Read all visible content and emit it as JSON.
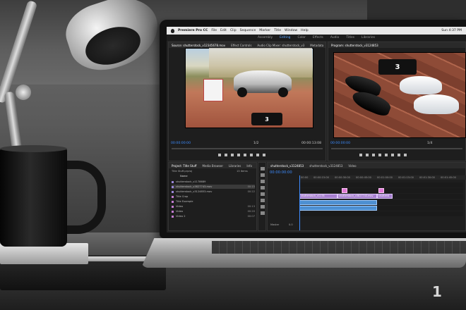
{
  "scene": {
    "brand_mark": "1"
  },
  "menubar": {
    "app_name": "Premiere Pro CC",
    "items": [
      "File",
      "Edit",
      "Clip",
      "Sequence",
      "Marker",
      "Title",
      "Window",
      "Help"
    ],
    "clock": "Sun 4:37 PM"
  },
  "workspaces": [
    "Assembly",
    "Editing",
    "Color",
    "Effects",
    "Audio",
    "Titles",
    "Libraries"
  ],
  "workspace_active": "Editing",
  "source_monitor": {
    "tabs": [
      "Source: shutterstock_v12345678.mov",
      "Effect Controls",
      "Audio Clip Mixer: shutterstock_v3",
      "Metadata"
    ],
    "timecode_left": "00:00:00:00",
    "timecode_right": "00:00:13:08",
    "zoom": "1/2",
    "logo": "3"
  },
  "program_monitor": {
    "tabs": [
      "Program: shutterstock_v3124853"
    ],
    "timecode_left": "00:00:00:00",
    "zoom": "1/4",
    "logo": "3"
  },
  "project": {
    "tabs": [
      "Project: Title Stuff",
      "Media Browser",
      "Libraries",
      "Info"
    ],
    "path": "Title Stuff.prproj",
    "item_count": "13 Items",
    "col_name": "Name",
    "rows": [
      {
        "name": "shutterstock_v1178689",
        "dur": "",
        "color": "#9a86d8"
      },
      {
        "name": "shutterstock_v3827743.mov",
        "dur": "00:15",
        "color": "#9a86d8"
      },
      {
        "name": "shutterstock_v3124853.mov",
        "dur": "00:22",
        "color": "#9a86d8"
      },
      {
        "name": "Title Crop",
        "dur": "",
        "color": "#c27bd0"
      },
      {
        "name": "Title Example",
        "dur": "",
        "color": "#c27bd0"
      },
      {
        "name": "Video",
        "dur": "00:13",
        "color": "#c27bd0"
      },
      {
        "name": "Video",
        "dur": "00:20",
        "color": "#c27bd0"
      },
      {
        "name": "Video 2",
        "dur": "00:07",
        "color": "#c27bd0"
      }
    ]
  },
  "timeline": {
    "tabs": [
      "shutterstock_v3124853",
      "shutterstock_v3124853",
      "Video"
    ],
    "timecode": "00:00:00:00",
    "ruler": [
      "00:00",
      "00:00:15:00",
      "00:00:30:00",
      "00:00:45:00",
      "00:01:00:00",
      "00:01:15:00",
      "00:01:30:00",
      "00:01:45:00"
    ],
    "video_clips": [
      "shutterstock_v1178",
      "shutterstock_v3827743.mov",
      "shutterst"
    ],
    "audio_clips": [
      "",
      ""
    ],
    "master": "Master",
    "master_value": "0.0"
  }
}
